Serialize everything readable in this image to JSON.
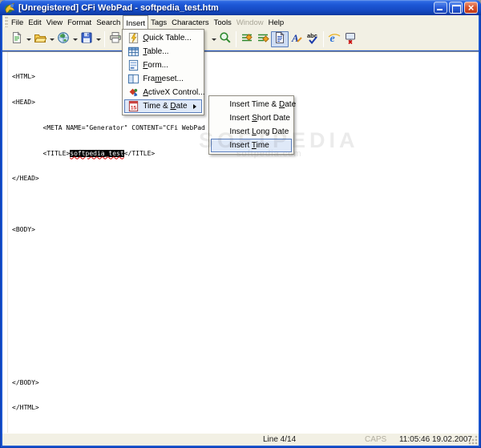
{
  "window": {
    "title": "[Unregistered] CFi WebPad - softpedia_test.htm",
    "controls": [
      "minimize-icon",
      "maximize-icon",
      "close-icon"
    ]
  },
  "menubar": {
    "items": [
      {
        "label": "File"
      },
      {
        "label": "Edit"
      },
      {
        "label": "View"
      },
      {
        "label": "Format"
      },
      {
        "label": "Search"
      },
      {
        "label": "Insert",
        "state": "open"
      },
      {
        "label": "Tags"
      },
      {
        "label": "Characters"
      },
      {
        "label": "Tools"
      },
      {
        "label": "Window",
        "state": "disabled"
      },
      {
        "label": "Help"
      }
    ]
  },
  "toolbar": {
    "buttons": [
      {
        "icon": "new-document-icon",
        "dropdown": true
      },
      {
        "icon": "open-folder-icon",
        "dropdown": true
      },
      {
        "icon": "browser-globe-icon",
        "dropdown": true
      },
      {
        "icon": "save-icon",
        "dropdown": true
      },
      {
        "icon": "print-icon",
        "dropdown": true
      },
      {
        "icon": "search-icon",
        "dropdown": false
      },
      {
        "icon": "insert-tag-icon",
        "dropdown": false
      },
      {
        "icon": "edit-tag-icon",
        "dropdown": false
      },
      {
        "icon": "source-view-icon",
        "dropdown": false,
        "state": "pressed"
      },
      {
        "icon": "font-icon",
        "dropdown": false
      },
      {
        "icon": "spellcheck-icon",
        "dropdown": false
      },
      {
        "icon": "internet-explorer-icon",
        "dropdown": false
      },
      {
        "icon": "work-offline-icon",
        "dropdown": false
      }
    ]
  },
  "insert_menu": {
    "items": [
      {
        "label": "Quick Table...",
        "mnemonic": "Q",
        "icon": "quick-table-icon"
      },
      {
        "label": "Table...",
        "mnemonic": "T",
        "icon": "table-icon"
      },
      {
        "label": "Form...",
        "mnemonic": "F",
        "icon": "form-icon"
      },
      {
        "label": "Frameset...",
        "mnemonic": "m",
        "icon": "frameset-icon"
      },
      {
        "label": "ActiveX Control...",
        "mnemonic": "A",
        "icon": "activex-icon"
      },
      {
        "label": "Time & Date",
        "mnemonic": "D",
        "icon": "time-date-icon",
        "state": "highlighted",
        "has_submenu": true
      }
    ]
  },
  "time_date_submenu": {
    "items": [
      {
        "label": "Insert Time & Date",
        "mnemonic": "D"
      },
      {
        "label": "Insert Short Date",
        "mnemonic": "S"
      },
      {
        "label": "Insert Long Date",
        "mnemonic": "L"
      },
      {
        "label": "Insert Time",
        "mnemonic": "T",
        "state": "highlighted"
      }
    ]
  },
  "editor": {
    "lines": [
      "<HTML>",
      "<HEAD>",
      "        <META NAME=\"Generator\" CONTENT=\"CFi WebPad 3.5\">",
      "        <TITLE>softpedia_test</TITLE>",
      "</HEAD>",
      "",
      "<BODY>",
      "",
      "",
      "",
      "",
      "",
      "</BODY>",
      "</HTML>"
    ],
    "selection": {
      "line_number": 4,
      "before": "        <TITLE>",
      "selected_text": "softpedia_test",
      "after": "</TITLE>"
    }
  },
  "statusbar": {
    "line_indicator": "Line 4/14",
    "caps": "CAPS",
    "clock": "11:05:46 19.02.2007"
  },
  "watermark": {
    "text": "SOFTPEDIA",
    "subtext": "softpedia.com"
  }
}
